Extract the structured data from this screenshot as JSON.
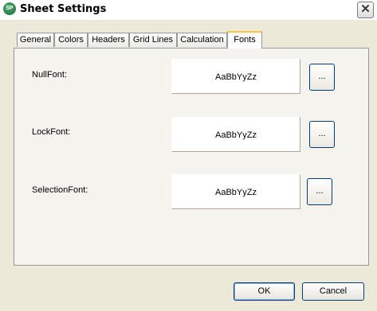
{
  "window": {
    "title": "Sheet Settings",
    "icon_text": "SP",
    "close_glyph": "✕"
  },
  "tabs": [
    {
      "label": "General"
    },
    {
      "label": "Colors"
    },
    {
      "label": "Headers"
    },
    {
      "label": "Grid Lines"
    },
    {
      "label": "Calculation"
    },
    {
      "label": "Fonts",
      "active": true
    }
  ],
  "fonts": [
    {
      "label": "NullFont:",
      "preview": "AaBbYyZz",
      "button": "..."
    },
    {
      "label": "LockFont:",
      "preview": "AaBbYyZz",
      "button": "..."
    },
    {
      "label": "SelectionFont:",
      "preview": "AaBbYyZz",
      "button": "..."
    }
  ],
  "buttons": {
    "ok": "OK",
    "cancel": "Cancel"
  },
  "colors": {
    "face": "#ece9d8",
    "active_tab_accent": "#ffc83c",
    "button_border": "#003c74"
  }
}
